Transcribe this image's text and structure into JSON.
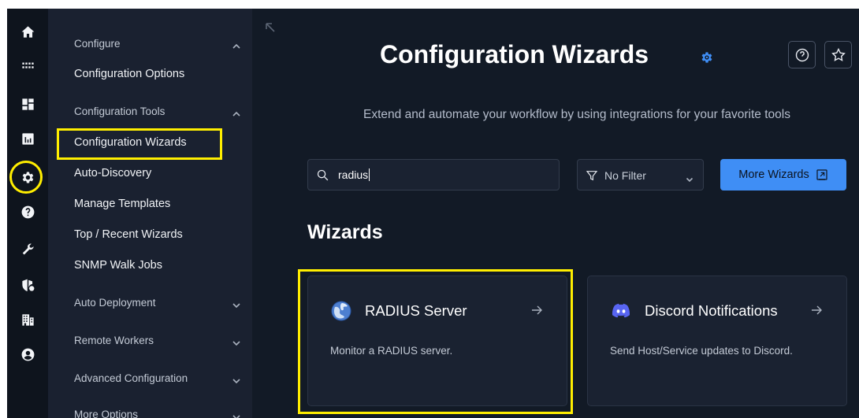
{
  "rail": {
    "icons": [
      "home-icon",
      "grid-apps-icon",
      "dashboard-icon",
      "reports-icon",
      "gear-icon",
      "help-icon",
      "wrench-icon",
      "shield-icon",
      "building-icon",
      "user-icon"
    ],
    "active": "gear-icon"
  },
  "menu": {
    "sections": {
      "configure": "Configure",
      "config_tools": "Configuration Tools",
      "auto_deployment": "Auto Deployment",
      "remote_workers": "Remote Workers",
      "advanced_configuration": "Advanced Configuration",
      "more_options": "More Options"
    },
    "items": {
      "configuration_options": "Configuration Options",
      "configuration_wizards": "Configuration Wizards",
      "auto_discovery": "Auto-Discovery",
      "manage_templates": "Manage Templates",
      "top_recent_wizards": "Top / Recent Wizards",
      "snmp_walk_jobs": "SNMP Walk Jobs"
    },
    "selected": "Configuration Wizards"
  },
  "header": {
    "title": "Configuration Wizards",
    "subtitle": "Extend and automate your workflow by using integrations for your favorite tools"
  },
  "toolbar": {
    "search_value": "radius",
    "filter_label": "No Filter",
    "more_wizards_label": "More Wizards"
  },
  "wizards": {
    "heading": "Wizards",
    "cards": [
      {
        "title": "RADIUS Server",
        "description": "Monitor a RADIUS server.",
        "icon": "globe-icon"
      },
      {
        "title": "Discord Notifications",
        "description": "Send Host/Service updates to Discord.",
        "icon": "discord-icon"
      }
    ]
  },
  "colors": {
    "highlight": "#ffee00",
    "accent_button": "#3f8ef5",
    "discord": "#5865f2",
    "background": "#121a26"
  }
}
